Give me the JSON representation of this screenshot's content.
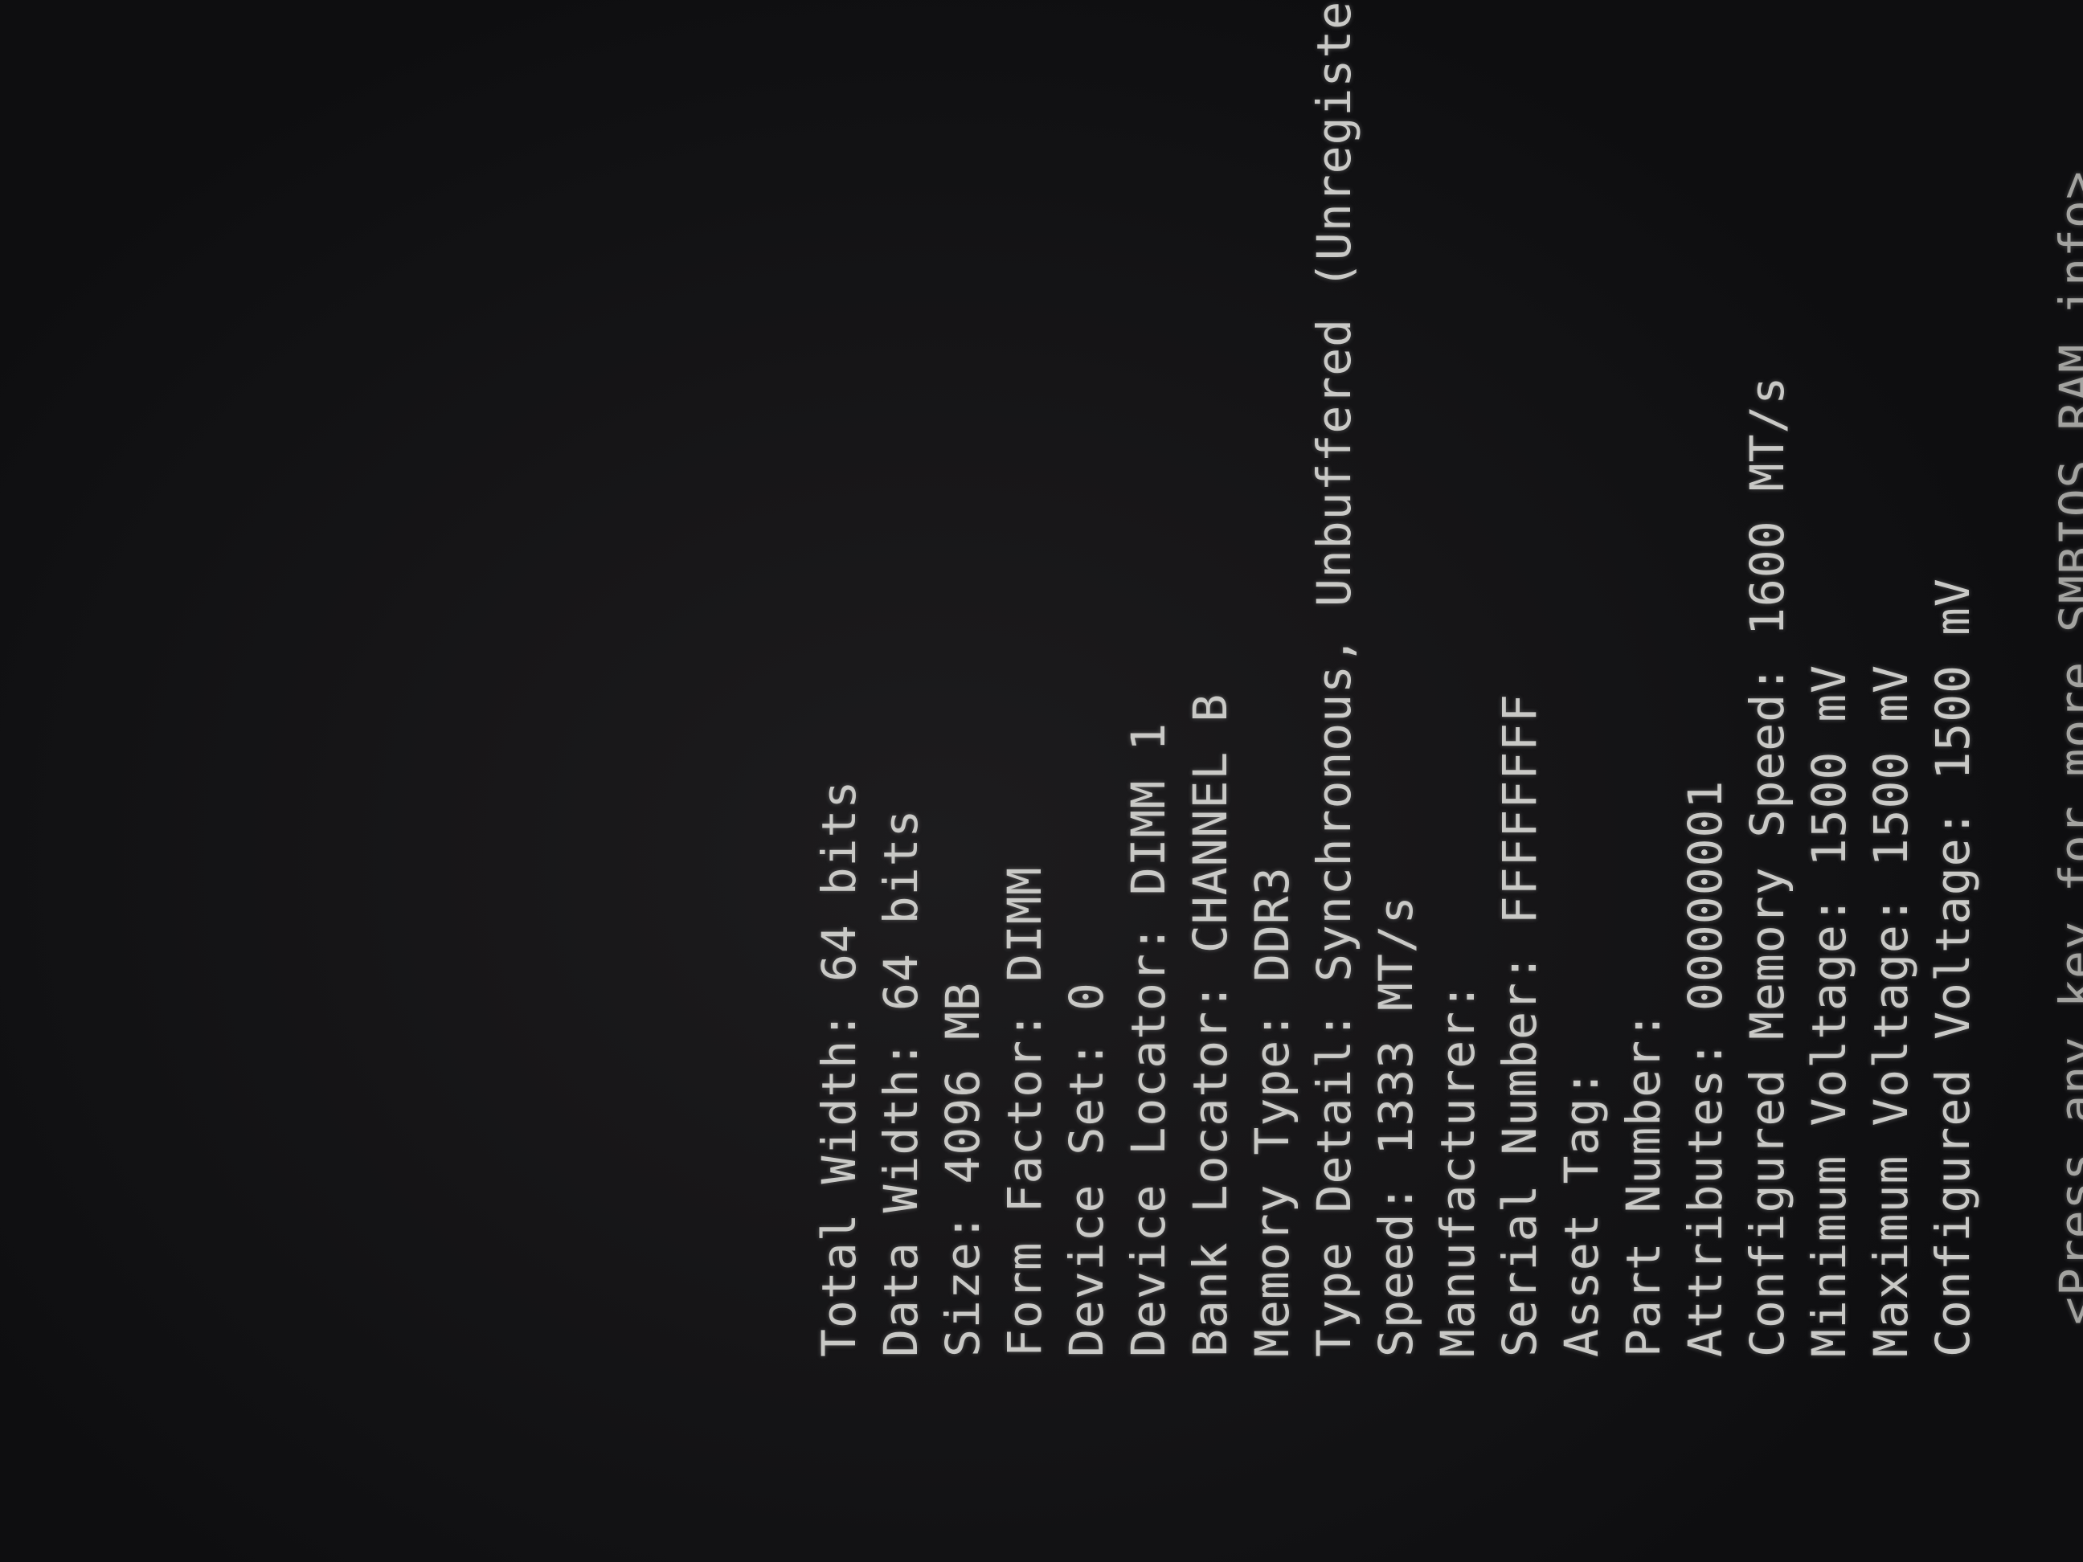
{
  "lines": [
    "Total Width: 64 bits",
    "Data Width: 64 bits",
    "Size: 4096 MB",
    "Form Factor: DIMM",
    "Device Set: 0",
    "Device Locator: DIMM 1",
    "Bank Locator: CHANNEL B",
    "Memory Type: DDR3",
    "Type Detail: Synchronous, Unbuffered (Unregistered)",
    "Speed: 1333 MT/s",
    "Manufacturer:",
    "Serial Number: FFFFFFFF",
    "Asset Tag:",
    "Part Number:",
    "Attributes: 00000001",
    "Configured Memory Speed: 1600 MT/s",
    "Minimum Voltage: 1500 mV",
    "Maximum Voltage: 1500 mV",
    "Configured Voltage: 1500 mV"
  ],
  "footer": "<Press any key for more SMBIOS RAM info>"
}
